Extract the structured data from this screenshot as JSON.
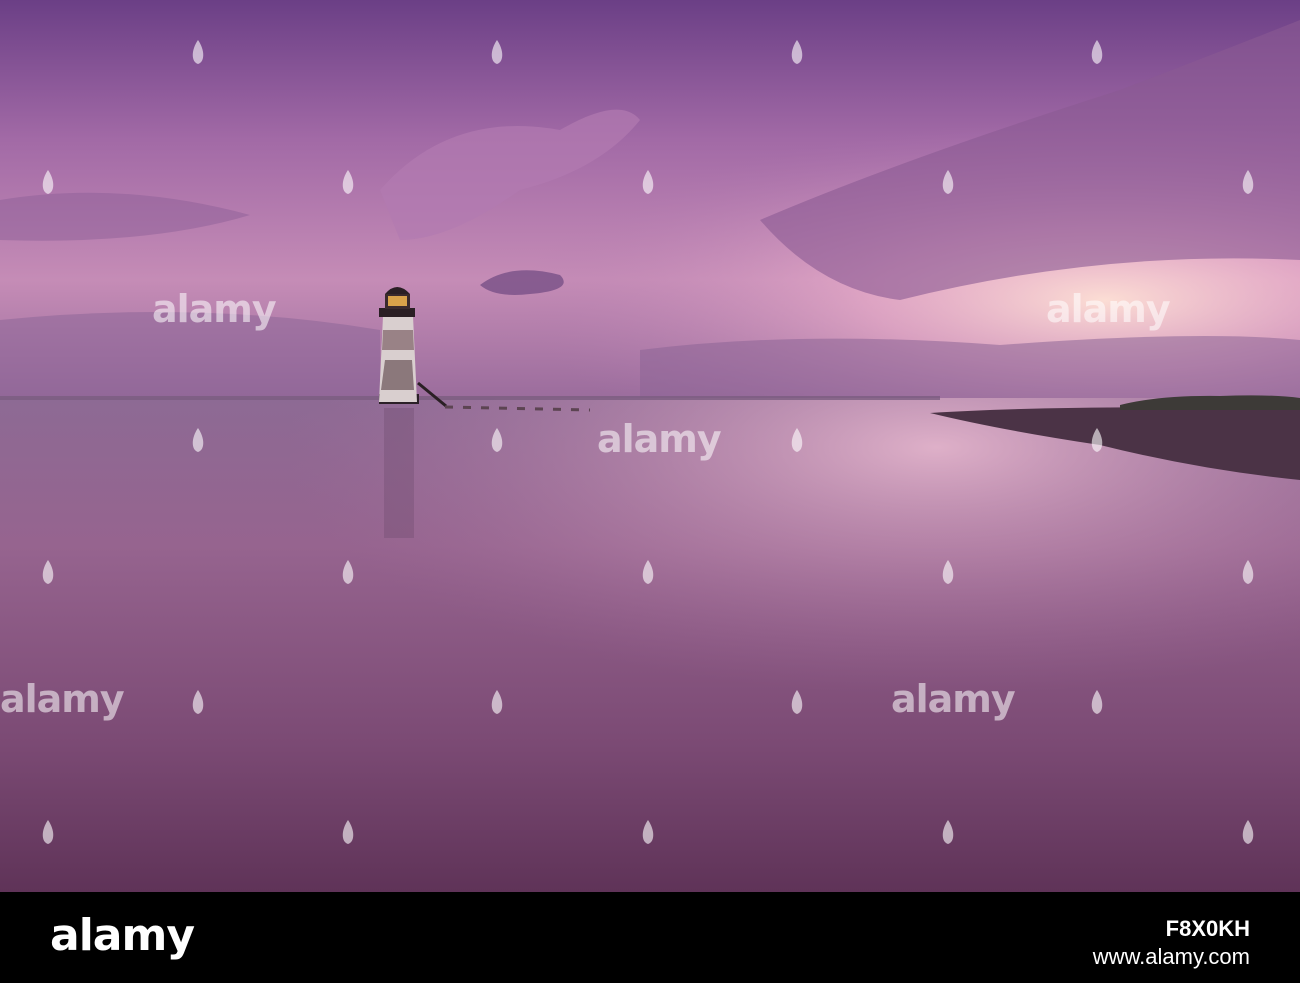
{
  "watermark": {
    "text": "alamy"
  },
  "footer": {
    "logo": "alamy",
    "image_code": "F8X0KH",
    "url": "www.alamy.com"
  },
  "colors": {
    "sky_top": "#6e3f8a",
    "sky_glow": "#f6c9d8",
    "sea": "#8a5a8e",
    "beach_dark": "#4a2f45",
    "lighthouse": "#2a1f24"
  }
}
